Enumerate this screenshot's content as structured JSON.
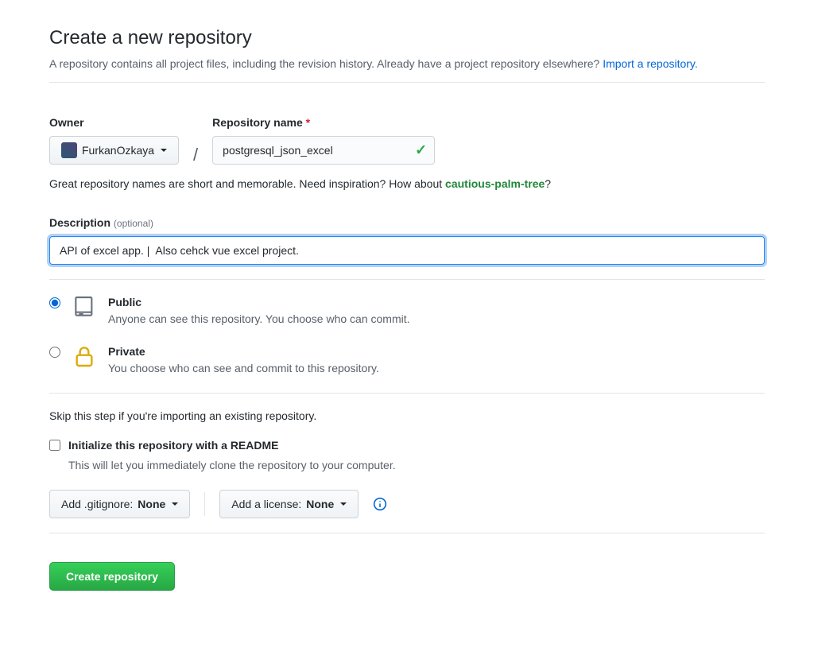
{
  "page": {
    "title": "Create a new repository",
    "subhead_text": "A repository contains all project files, including the revision history. Already have a project repository elsewhere? ",
    "import_link": "Import a repository."
  },
  "owner": {
    "label": "Owner",
    "name": "FurkanOzkaya"
  },
  "repo_name": {
    "label": "Repository name",
    "required_marker": "*",
    "value": "postgresql_json_excel"
  },
  "name_note": {
    "prefix": "Great repository names are short and memorable. Need inspiration? How about ",
    "suggestion": "cautious-palm-tree",
    "suffix": "?"
  },
  "description": {
    "label": "Description",
    "optional": "(optional)",
    "value": "API of excel app. |  Also cehck vue excel project."
  },
  "visibility": {
    "public": {
      "title": "Public",
      "desc": "Anyone can see this repository. You choose who can commit."
    },
    "private": {
      "title": "Private",
      "desc": "You choose who can see and commit to this repository."
    }
  },
  "init": {
    "skip_note": "Skip this step if you're importing an existing repository.",
    "readme_label": "Initialize this repository with a README",
    "readme_desc": "This will let you immediately clone the repository to your computer."
  },
  "selectors": {
    "gitignore_prefix": "Add .gitignore: ",
    "gitignore_value": "None",
    "license_prefix": "Add a license: ",
    "license_value": "None"
  },
  "submit": {
    "label": "Create repository"
  }
}
